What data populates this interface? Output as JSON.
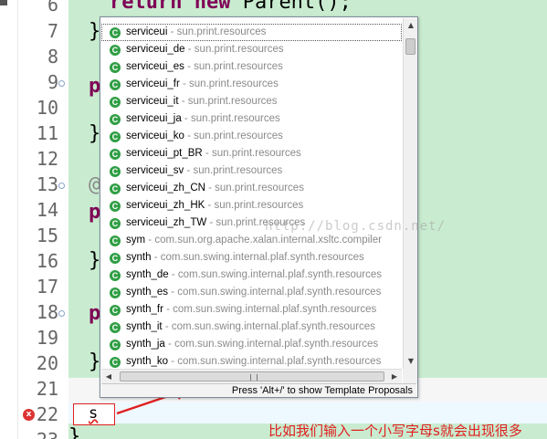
{
  "line_numbers": [
    "6",
    "7",
    "8",
    "9",
    "10",
    "11",
    "12",
    "13",
    "14",
    "15",
    "16",
    "17",
    "18",
    "19",
    "20",
    "21",
    "22",
    "23"
  ],
  "code": {
    "top_line": "return new Parent();",
    "brace_7": "}",
    "p_9": "p",
    "brace_11": "}",
    "at_13": "@",
    "p_14": "p",
    "brace_16": "}",
    "p_18": "p",
    "brace_20": "}",
    "brace_23": "}"
  },
  "typed_text": "s",
  "error_marker": "x",
  "autocomplete": {
    "items": [
      {
        "name": "serviceui",
        "pkg": "sun.print.resources",
        "icon": "class-icon"
      },
      {
        "name": "serviceui_de",
        "pkg": "sun.print.resources",
        "icon": "class-icon"
      },
      {
        "name": "serviceui_es",
        "pkg": "sun.print.resources",
        "icon": "class-icon"
      },
      {
        "name": "serviceui_fr",
        "pkg": "sun.print.resources",
        "icon": "class-icon"
      },
      {
        "name": "serviceui_it",
        "pkg": "sun.print.resources",
        "icon": "class-icon"
      },
      {
        "name": "serviceui_ja",
        "pkg": "sun.print.resources",
        "icon": "class-icon"
      },
      {
        "name": "serviceui_ko",
        "pkg": "sun.print.resources",
        "icon": "class-icon"
      },
      {
        "name": "serviceui_pt_BR",
        "pkg": "sun.print.resources",
        "icon": "class-icon"
      },
      {
        "name": "serviceui_sv",
        "pkg": "sun.print.resources",
        "icon": "class-icon"
      },
      {
        "name": "serviceui_zh_CN",
        "pkg": "sun.print.resources",
        "icon": "class-icon"
      },
      {
        "name": "serviceui_zh_HK",
        "pkg": "sun.print.resources",
        "icon": "class-icon"
      },
      {
        "name": "serviceui_zh_TW",
        "pkg": "sun.print.resources",
        "icon": "class-icon"
      },
      {
        "name": "sym",
        "pkg": "com.sun.org.apache.xalan.internal.xsltc.compiler",
        "icon": "class-icon"
      },
      {
        "name": "synth",
        "pkg": "com.sun.swing.internal.plaf.synth.resources",
        "icon": "class-icon"
      },
      {
        "name": "synth_de",
        "pkg": "com.sun.swing.internal.plaf.synth.resources",
        "icon": "class-icon"
      },
      {
        "name": "synth_es",
        "pkg": "com.sun.swing.internal.plaf.synth.resources",
        "icon": "class-icon"
      },
      {
        "name": "synth_fr",
        "pkg": "com.sun.swing.internal.plaf.synth.resources",
        "icon": "class-icon"
      },
      {
        "name": "synth_it",
        "pkg": "com.sun.swing.internal.plaf.synth.resources",
        "icon": "class-icon"
      },
      {
        "name": "synth_ja",
        "pkg": "com.sun.swing.internal.plaf.synth.resources",
        "icon": "class-icon"
      },
      {
        "name": "synth_ko",
        "pkg": "com.sun.swing.internal.plaf.synth.resources",
        "icon": "class-icon"
      }
    ],
    "status": "Press 'Alt+/' to show Template Proposals"
  },
  "watermark": "http://blog.csdn.net/",
  "annotation": "比如我们输入一个小写字母s就会出现很多",
  "colors": {
    "editor_bg": "#c9ecd0",
    "keyword": "#7f0055",
    "annotation": "#e02020",
    "class_icon": "#2f9e44"
  }
}
